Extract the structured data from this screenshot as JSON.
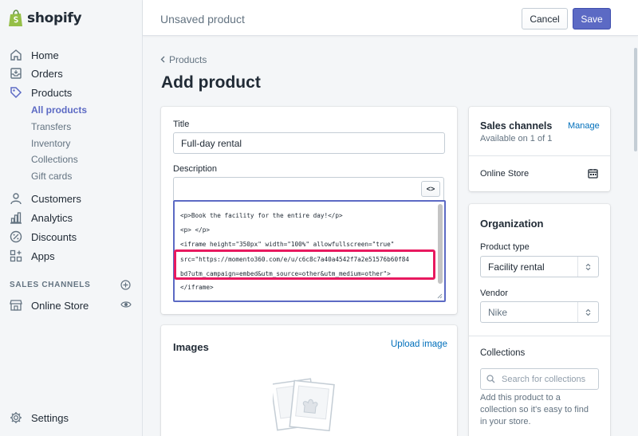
{
  "brand": {
    "name": "shopify",
    "accent": "#5c6ac4",
    "highlight_color": "#e8195f"
  },
  "sidebar": {
    "items": [
      {
        "label": "Home",
        "icon": "home-icon"
      },
      {
        "label": "Orders",
        "icon": "orders-icon"
      },
      {
        "label": "Products",
        "icon": "tag-icon"
      }
    ],
    "product_subitems": [
      "All products",
      "Transfers",
      "Inventory",
      "Collections",
      "Gift cards"
    ],
    "items2": [
      {
        "label": "Customers",
        "icon": "person-icon"
      },
      {
        "label": "Analytics",
        "icon": "bar-chart-icon"
      },
      {
        "label": "Discounts",
        "icon": "discount-icon"
      },
      {
        "label": "Apps",
        "icon": "apps-icon"
      }
    ],
    "sales_channels_title": "SALES CHANNELS",
    "online_store": "Online Store",
    "settings": "Settings"
  },
  "topbar": {
    "title": "Unsaved product",
    "cancel": "Cancel",
    "save": "Save"
  },
  "breadcrumb": "Products",
  "page_title": "Add product",
  "form": {
    "title_label": "Title",
    "title_value": "Full-day rental",
    "description_label": "Description",
    "code_toggle": "<>",
    "code_lines": [
      "<p>Book the facility for the entire day!</p>",
      "<p> </p>",
      "<iframe height=\"350px\" width=\"100%\" allowfullscreen=\"true\"",
      "src=\"https://momento360.com/e/u/c6c8c7a40a4542f7a2e51576b60f84",
      "bd?utm_campaign=embed&utm_source=other&utm_medium=other\">",
      "</iframe>"
    ]
  },
  "images": {
    "heading": "Images",
    "upload": "Upload image"
  },
  "sales_channels": {
    "heading": "Sales channels",
    "manage": "Manage",
    "available": "Available on 1 of 1",
    "channel": "Online Store"
  },
  "organization": {
    "heading": "Organization",
    "product_type_label": "Product type",
    "product_type_value": "Facility rental",
    "vendor_label": "Vendor",
    "vendor_value": "Nike",
    "collections_label": "Collections",
    "collections_placeholder": "Search for collections",
    "help": [
      "Add this product to a",
      "collection so it's easy to find",
      "in your store."
    ]
  }
}
